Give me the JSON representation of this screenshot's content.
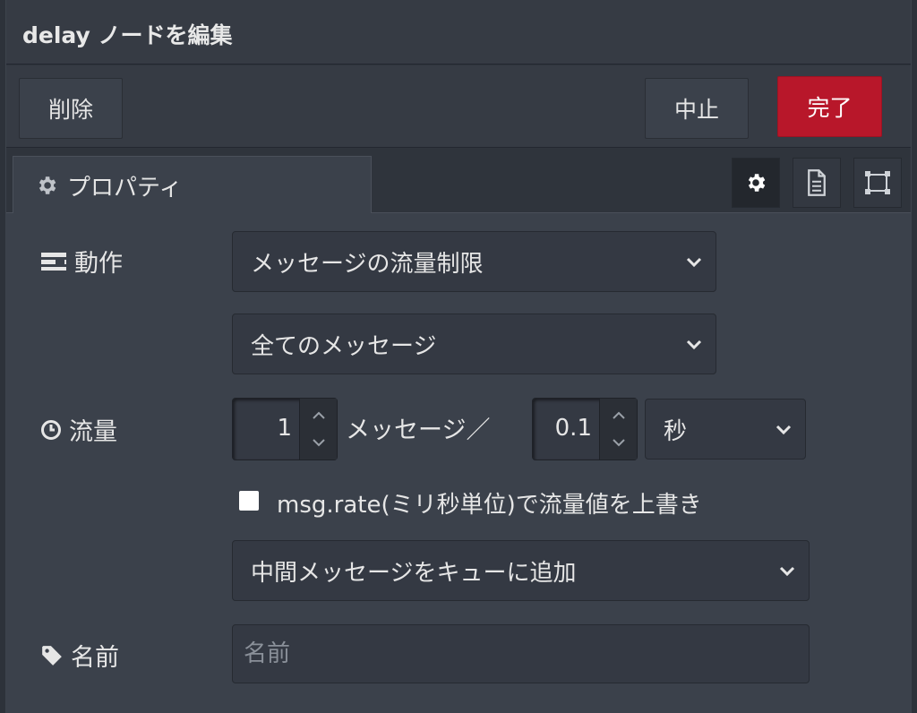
{
  "dialog": {
    "title": "delay ノードを編集",
    "delete_label": "削除",
    "cancel_label": "中止",
    "done_label": "完了",
    "done_color": "#b8172a"
  },
  "tabs": {
    "properties_label": "プロパティ",
    "icons": [
      "gear-icon",
      "document-icon",
      "frame-icon"
    ]
  },
  "form": {
    "action_label": "動作",
    "action_value": "メッセージの流量制限",
    "scope_value": "全てのメッセージ",
    "rate_label": "流量",
    "rate_count": "1",
    "rate_middle_text": "メッセージ／",
    "rate_interval": "0.1",
    "rate_unit": "秒",
    "override_label": "msg.rate(ミリ秒単位)で流量値を上書き",
    "override_checked": false,
    "queue_value": "中間メッセージをキューに追加",
    "name_label": "名前",
    "name_placeholder": "名前",
    "name_value": ""
  }
}
